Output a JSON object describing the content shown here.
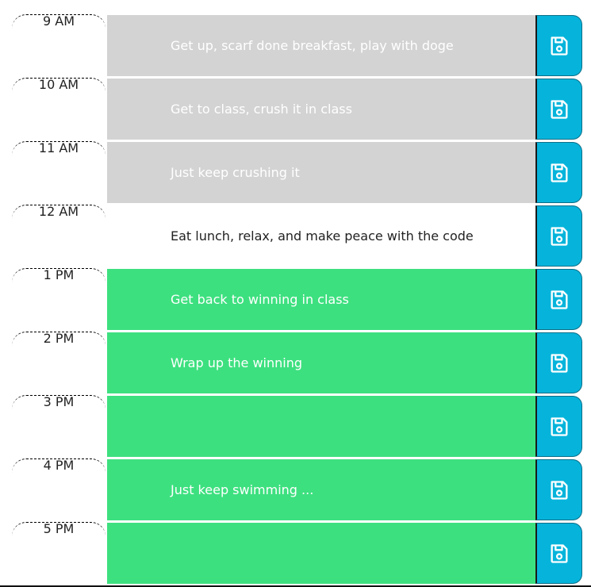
{
  "colors": {
    "past": "#d3d3d3",
    "present": "#ffffff",
    "future": "#3de07f",
    "save_button": "#06b4db"
  },
  "schedule": [
    {
      "hour": "9 AM",
      "task": "Get up, scarf done breakfast, play with doge",
      "state": "past",
      "icon": "floppy-disk-icon"
    },
    {
      "hour": "10 AM",
      "task": " Get to class, crush it in class",
      "state": "past",
      "icon": "floppy-disk-icon"
    },
    {
      "hour": "11 AM",
      "task": "Just keep crushing it",
      "state": "past",
      "icon": "floppy-disk-icon"
    },
    {
      "hour": "12 AM",
      "task": "Eat lunch, relax, and make peace with the code",
      "state": "present",
      "icon": "floppy-disk-icon"
    },
    {
      "hour": "1 PM",
      "task": "Get back to winning in class",
      "state": "future",
      "icon": "floppy-disk-icon"
    },
    {
      "hour": "2 PM",
      "task": " Wrap up the winning",
      "state": "future",
      "icon": "floppy-disk-icon"
    },
    {
      "hour": "3 PM",
      "task": "",
      "state": "future",
      "icon": "floppy-disk-icon"
    },
    {
      "hour": "4 PM",
      "task": " Just keep swimming ...",
      "state": "future",
      "icon": "floppy-disk-icon"
    },
    {
      "hour": "5 PM",
      "task": "",
      "state": "future",
      "icon": "floppy-disk-icon"
    }
  ]
}
